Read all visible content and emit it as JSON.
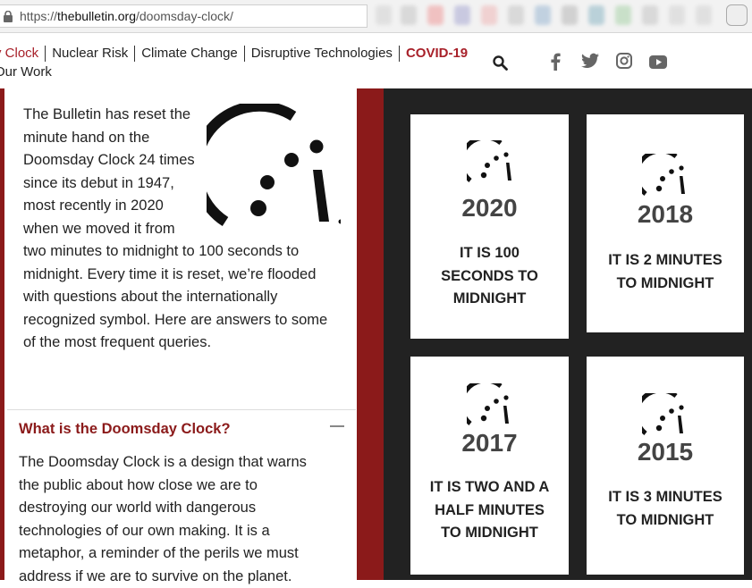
{
  "browser": {
    "url_prefix": "https://",
    "url_domain": "thebulletin.org",
    "url_path": "/doomsday-clock/"
  },
  "nav": {
    "items": [
      {
        "label": "y Clock"
      },
      {
        "label": "Nuclear Risk"
      },
      {
        "label": "Climate Change"
      },
      {
        "label": "Disruptive Technologies"
      },
      {
        "label": "COVID-19"
      }
    ],
    "second_row": "Our Work"
  },
  "intro_text": "The Bulletin has reset the minute hand on the Doomsday Clock 24 times since its debut in 1947, most recently in 2020 when we moved it from two minutes to midnight to 100 seconds to midnight. Every time it is reset, we’re flooded with questions about the internationally recognized symbol. Here are answers to some of the most frequent queries.",
  "faq": {
    "question": "What is the Doomsday Clock?",
    "answer": "The Doomsday Clock is a design that warns the public about how close we are to destroying our world with dangerous technologies of our own making. It is a metaphor, a reminder of the perils we must address if we are to survive on the planet."
  },
  "cards": [
    {
      "year": "2020",
      "caption": "IT IS 100 SECONDS TO MIDNIGHT"
    },
    {
      "year": "2018",
      "caption": "IT IS 2 MINUTES TO MIDNIGHT"
    },
    {
      "year": "2017",
      "caption": "IT IS TWO AND A HALF MINUTES TO MIDNIGHT"
    },
    {
      "year": "2015",
      "caption": "IT IS 3 MINUTES TO MIDNIGHT"
    }
  ],
  "icons": {
    "lock": "lock-icon",
    "search": "search-icon",
    "social": [
      "facebook-icon",
      "twitter-icon",
      "instagram-icon",
      "youtube-icon"
    ]
  },
  "colors": {
    "brand_red": "#8b1a1a",
    "covid_red": "#a8212a",
    "dark_panel": "#222222"
  }
}
